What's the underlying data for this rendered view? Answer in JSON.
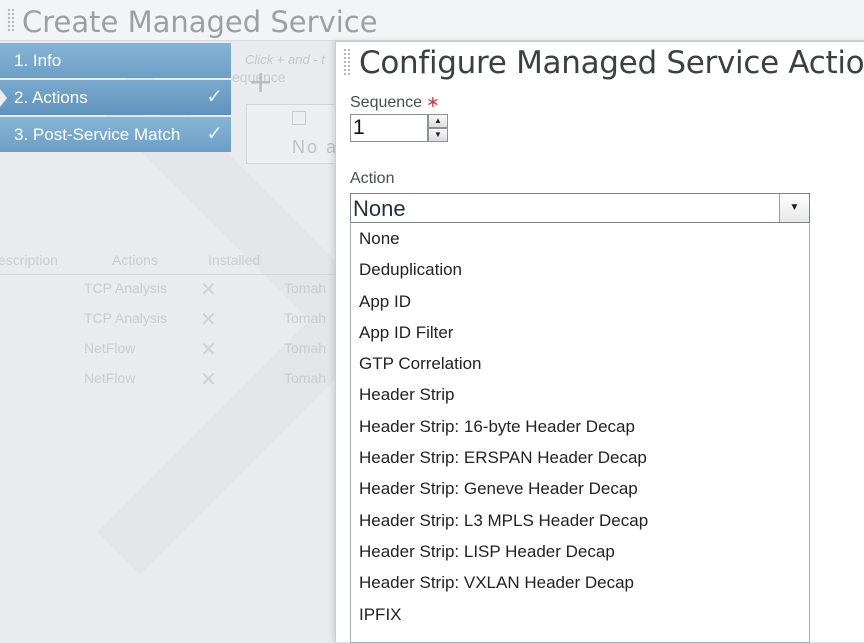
{
  "background": {
    "title": "Create Managed Service",
    "wizard_steps": [
      {
        "label": "1. Info",
        "checked": false
      },
      {
        "label": "2. Actions",
        "checked": true
      },
      {
        "label": "3. Post-Service Match",
        "checked": true
      }
    ],
    "actions_hint": "Click + and - t",
    "actions_hint2": "equence",
    "no_actions_text": "No a",
    "table_headers": [
      "escription",
      "Actions",
      "Installed"
    ],
    "table_rows": [
      {
        "actions": "TCP Analysis",
        "owner": "Tomah"
      },
      {
        "actions": "TCP Analysis",
        "owner": "Tomah"
      },
      {
        "actions": "NetFlow",
        "owner": "Tomah"
      },
      {
        "actions": "NetFlow",
        "owner": "Tomah"
      }
    ],
    "row_mark": "✕"
  },
  "dialog": {
    "title": "Configure Managed Service Action",
    "sequence_label": "Sequence",
    "required_marker": "∗",
    "sequence_value": "1",
    "action_label": "Action",
    "action_selected": "None",
    "action_options": [
      "None",
      "Deduplication",
      "App ID",
      "App ID Filter",
      "GTP Correlation",
      "Header Strip",
      "Header Strip: 16-byte Header Decap",
      "Header Strip: ERSPAN Header Decap",
      "Header Strip: Geneve Header Decap",
      "Header Strip: L3 MPLS Header Decap",
      "Header Strip: LISP Header Decap",
      "Header Strip: VXLAN Header Decap",
      "IPFIX"
    ]
  },
  "icons": {
    "step_check": "checkmark-icon",
    "spinner_up": "triangle-up-icon",
    "spinner_down": "triangle-down-icon",
    "select_arrow": "triangle-down-icon",
    "row_mark": "x-mark-icon"
  },
  "colors": {
    "wizard_step": "#6d9fc6",
    "required": "#d23a3a"
  }
}
